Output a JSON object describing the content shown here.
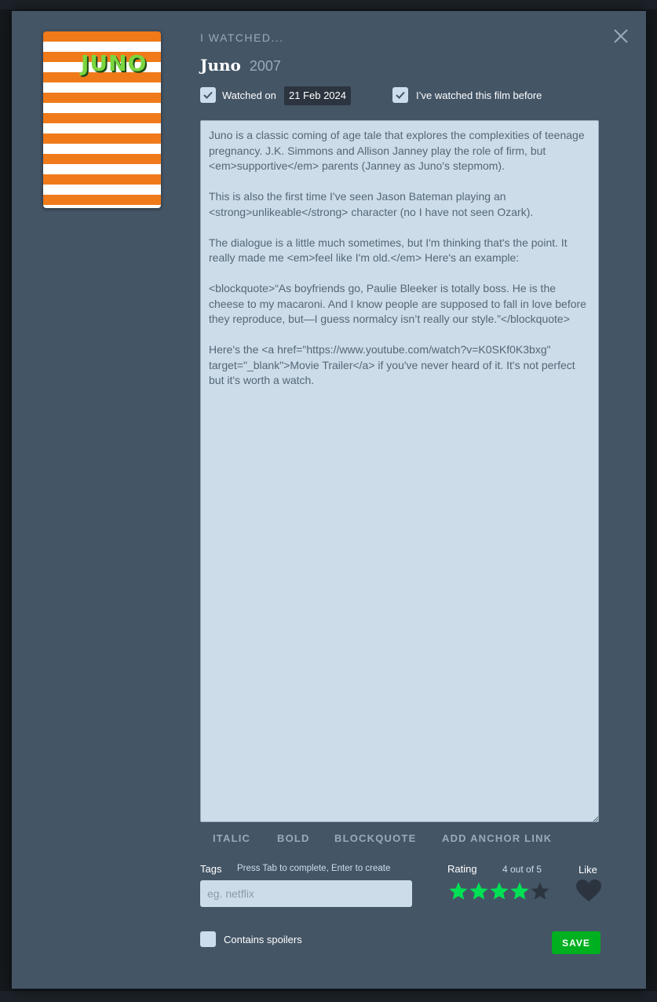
{
  "modal": {
    "heading": "I WATCHED...",
    "film_title": "Juno",
    "film_year": "2007",
    "poster_title": "JUNO",
    "watched_on_label": "Watched on",
    "watched_on_checked": true,
    "watched_date": "21 Feb 2024",
    "rewatch_label": "I’ve watched this film before",
    "rewatch_checked": true,
    "review_text": "Juno is a classic coming of age tale that explores the complexities of teenage pregnancy. J.K. Simmons and Allison Janney play the role of firm, but <em>supportive</em> parents (Janney as Juno's stepmom).\n\nThis is also the first time I've seen Jason Bateman playing an <strong>unlikeable</strong> character (no I have not seen Ozark).\n\nThe dialogue is a little much sometimes, but I'm thinking that's the point. It really made me <em>feel like I'm old.</em> Here's an example:\n\n<blockquote>“As boyfriends go, Paulie Bleeker is totally boss. He is the cheese to my macaroni. And I know people are supposed to fall in love before they reproduce, but—I guess normalcy isn’t really our style.”</blockquote>\n\nHere's the <a href=\"https://www.youtube.com/watch?v=K0SKf0K3bxg\" target=\"_blank\">Movie Trailer</a> if you've never heard of it. It's not perfect but it's worth a watch.",
    "format_buttons": [
      "ITALIC",
      "BOLD",
      "BLOCKQUOTE",
      "ADD ANCHOR LINK"
    ],
    "tags_label": "Tags",
    "tags_hint": "Press Tab to complete, Enter to create",
    "tags_placeholder": "eg. netflix",
    "rating_label": "Rating",
    "rating_text": "4 out of 5",
    "rating_value": 4,
    "rating_max": 5,
    "like_label": "Like",
    "liked": false,
    "spoilers_label": "Contains spoilers",
    "spoilers_checked": false,
    "save_label": "SAVE"
  },
  "colors": {
    "modal_bg": "#445566",
    "star_on": "#00e054",
    "star_off": "#2c3440",
    "save_bg": "#00b020",
    "field_bg": "#ccdde9"
  }
}
